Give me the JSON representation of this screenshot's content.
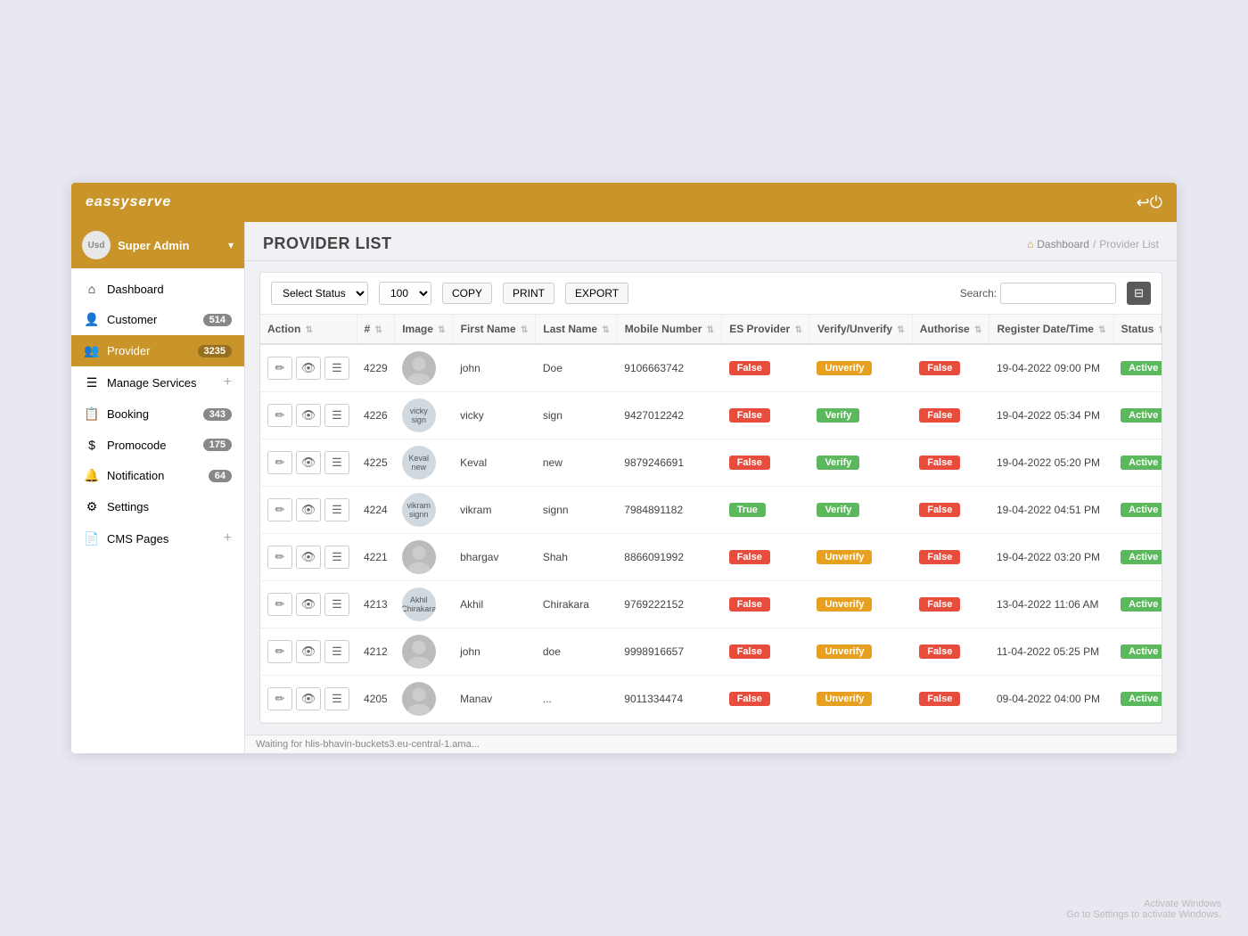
{
  "brand": "eassyserve",
  "topnav": {
    "arrow": "↩",
    "power": "⏻"
  },
  "sidebar": {
    "user": {
      "label": "Super Admin",
      "avatar": "Usd",
      "chevron": "▾"
    },
    "items": [
      {
        "id": "dashboard",
        "icon": "⌂",
        "label": "Dashboard",
        "badge": null,
        "active": false
      },
      {
        "id": "customer",
        "icon": "👤",
        "label": "Customer",
        "badge": "514",
        "active": false
      },
      {
        "id": "provider",
        "icon": "👥",
        "label": "Provider",
        "badge": "3235",
        "active": true
      },
      {
        "id": "manage-services",
        "icon": "☰",
        "label": "Manage Services",
        "badge": null,
        "plus": "+",
        "active": false
      },
      {
        "id": "booking",
        "icon": "📋",
        "label": "Booking",
        "badge": "343",
        "active": false
      },
      {
        "id": "promocode",
        "icon": "$",
        "label": "Promocode",
        "badge": "175",
        "active": false
      },
      {
        "id": "notification",
        "icon": "🔔",
        "label": "Notification",
        "badge": "64",
        "active": false
      },
      {
        "id": "settings",
        "icon": "⚙",
        "label": "Settings",
        "badge": null,
        "active": false
      },
      {
        "id": "cms-pages",
        "icon": "📄",
        "label": "CMS Pages",
        "badge": null,
        "plus": "+",
        "active": false
      }
    ]
  },
  "page": {
    "title": "PROVIDER LIST",
    "breadcrumb": [
      "Dashboard",
      "Provider List"
    ]
  },
  "toolbar": {
    "select_status_label": "Select Status",
    "per_page": "100",
    "copy_label": "COPY",
    "print_label": "PRINT",
    "export_label": "EXPORT",
    "search_label": "Search:"
  },
  "table": {
    "columns": [
      "Action",
      "#",
      "Image",
      "First Name",
      "Last Name",
      "Mobile Number",
      "ES Provider",
      "Verify/Unverify",
      "Authorise",
      "Register Date/Time",
      "Status"
    ],
    "rows": [
      {
        "id": "4229",
        "image_type": "avatar",
        "first_name": "john",
        "last_name": "Doe",
        "mobile": "9106663742",
        "es_provider": "False",
        "verify": "Unverify",
        "authorise": "False",
        "register_dt": "19-04-2022 09:00 PM",
        "status": "Active"
      },
      {
        "id": "4226",
        "image_type": "img",
        "image_alt": "vicky sign",
        "first_name": "vicky",
        "last_name": "sign",
        "mobile": "9427012242",
        "es_provider": "False",
        "verify": "Verify",
        "authorise": "False",
        "register_dt": "19-04-2022 05:34 PM",
        "status": "Active"
      },
      {
        "id": "4225",
        "image_type": "img",
        "image_alt": "Keval new",
        "first_name": "Keval",
        "last_name": "new",
        "mobile": "9879246691",
        "es_provider": "False",
        "verify": "Verify",
        "authorise": "False",
        "register_dt": "19-04-2022 05:20 PM",
        "status": "Active"
      },
      {
        "id": "4224",
        "image_type": "img",
        "image_alt": "vikram signn",
        "first_name": "vikram",
        "last_name": "signn",
        "mobile": "7984891182",
        "es_provider": "True",
        "verify": "Verify",
        "authorise": "False",
        "register_dt": "19-04-2022 04:51 PM",
        "status": "Active"
      },
      {
        "id": "4221",
        "image_type": "avatar",
        "first_name": "bhargav",
        "last_name": "Shah",
        "mobile": "8866091992",
        "es_provider": "False",
        "verify": "Unverify",
        "authorise": "False",
        "register_dt": "19-04-2022 03:20 PM",
        "status": "Active"
      },
      {
        "id": "4213",
        "image_type": "img",
        "image_alt": "Akhil Chirakara",
        "first_name": "Akhil",
        "last_name": "Chirakara",
        "mobile": "9769222152",
        "es_provider": "False",
        "verify": "Unverify",
        "authorise": "False",
        "register_dt": "13-04-2022 11:06 AM",
        "status": "Active"
      },
      {
        "id": "4212",
        "image_type": "avatar",
        "first_name": "john",
        "last_name": "doe",
        "mobile": "9998916657",
        "es_provider": "False",
        "verify": "Unverify",
        "authorise": "False",
        "register_dt": "11-04-2022 05:25 PM",
        "status": "Active"
      },
      {
        "id": "4205",
        "image_type": "avatar",
        "first_name": "Manav",
        "last_name": "...",
        "mobile": "9011334474",
        "es_provider": "False",
        "verify": "Unverify",
        "authorise": "False",
        "register_dt": "09-04-2022 04:00 PM",
        "status": "Active"
      }
    ]
  },
  "statusbar": {
    "text": "Waiting for hlis-bhavin-buckets3.eu-central-1.ama..."
  },
  "win_activate": {
    "line1": "Activate Windows",
    "line2": "Go to Settings to activate Windows."
  }
}
